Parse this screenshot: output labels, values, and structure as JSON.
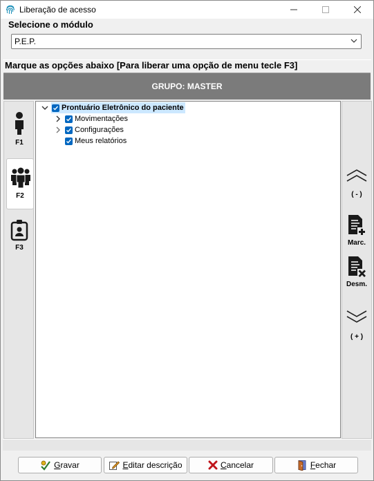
{
  "window": {
    "title": "Liberação de acesso"
  },
  "module": {
    "label": "Selecione o módulo",
    "selected": "P.E.P."
  },
  "instructions": "Marque as opções abaixo [Para liberar uma opção de menu tecle F3]",
  "group": {
    "label": "GRUPO: MASTER"
  },
  "left_panel": {
    "items": [
      {
        "label": "F1"
      },
      {
        "label": "F2"
      },
      {
        "label": "F3"
      }
    ]
  },
  "tree": {
    "root": "Prontuário Eletrônico do paciente",
    "children": [
      "Movimentações",
      "Configurações",
      "Meus relatórios"
    ]
  },
  "right_panel": {
    "collapse_label": "( - )",
    "mark_label": "Marc.",
    "unmark_label": "Desm.",
    "expand_label": "( + )"
  },
  "buttons": {
    "save": {
      "first": "G",
      "rest": "ravar"
    },
    "edit": {
      "first": "E",
      "rest": "ditar descrição"
    },
    "cancel": {
      "first": "C",
      "rest": "ancelar"
    },
    "close": {
      "first": "F",
      "rest": "echar"
    }
  },
  "colors": {
    "accent": "#0067c0",
    "group_bar": "#7b7b7b",
    "selection": "#cce8ff",
    "cancel_x": "#c0151b"
  }
}
